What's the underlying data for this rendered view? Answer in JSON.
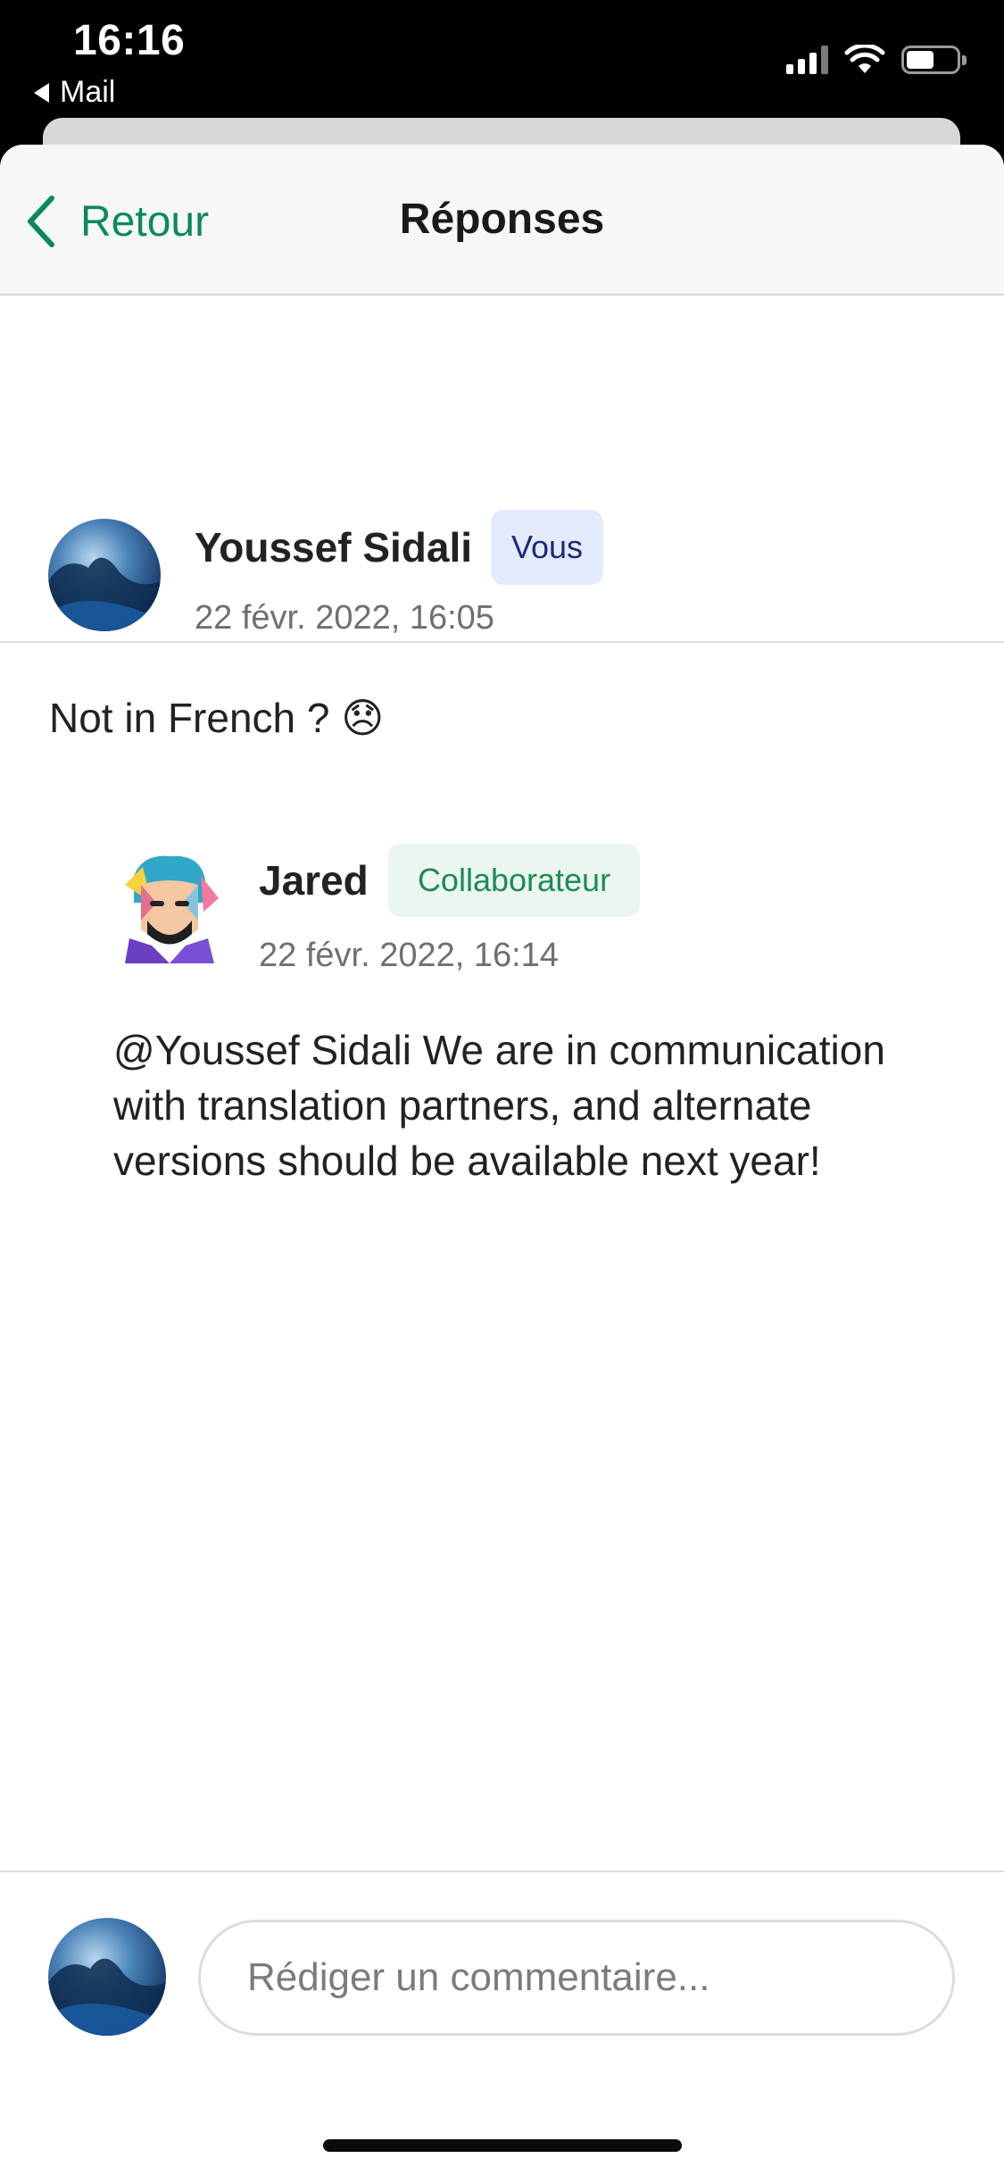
{
  "status_bar": {
    "time": "16:16",
    "back_app": "Mail"
  },
  "nav": {
    "back_label": "Retour",
    "title": "Réponses"
  },
  "comments": [
    {
      "author": "Youssef Sidali",
      "badge": "Vous",
      "timestamp": "22 févr. 2022, 16:05",
      "text": "Not in French ? 😞"
    },
    {
      "author": "Jared",
      "badge": "Collaborateur",
      "timestamp": "22 févr. 2022, 16:14",
      "text": "@Youssef Sidali We are in communication with translation partners, and alternate versions should be available next year!"
    }
  ],
  "composer": {
    "placeholder": "Rédiger un commentaire..."
  },
  "colors": {
    "accent": "#0a8a5a",
    "badge_you_bg": "#e3eafc",
    "badge_you_text": "#1b2a7a",
    "badge_collab_bg": "#eaf6ef",
    "badge_collab_text": "#1e8a55"
  }
}
